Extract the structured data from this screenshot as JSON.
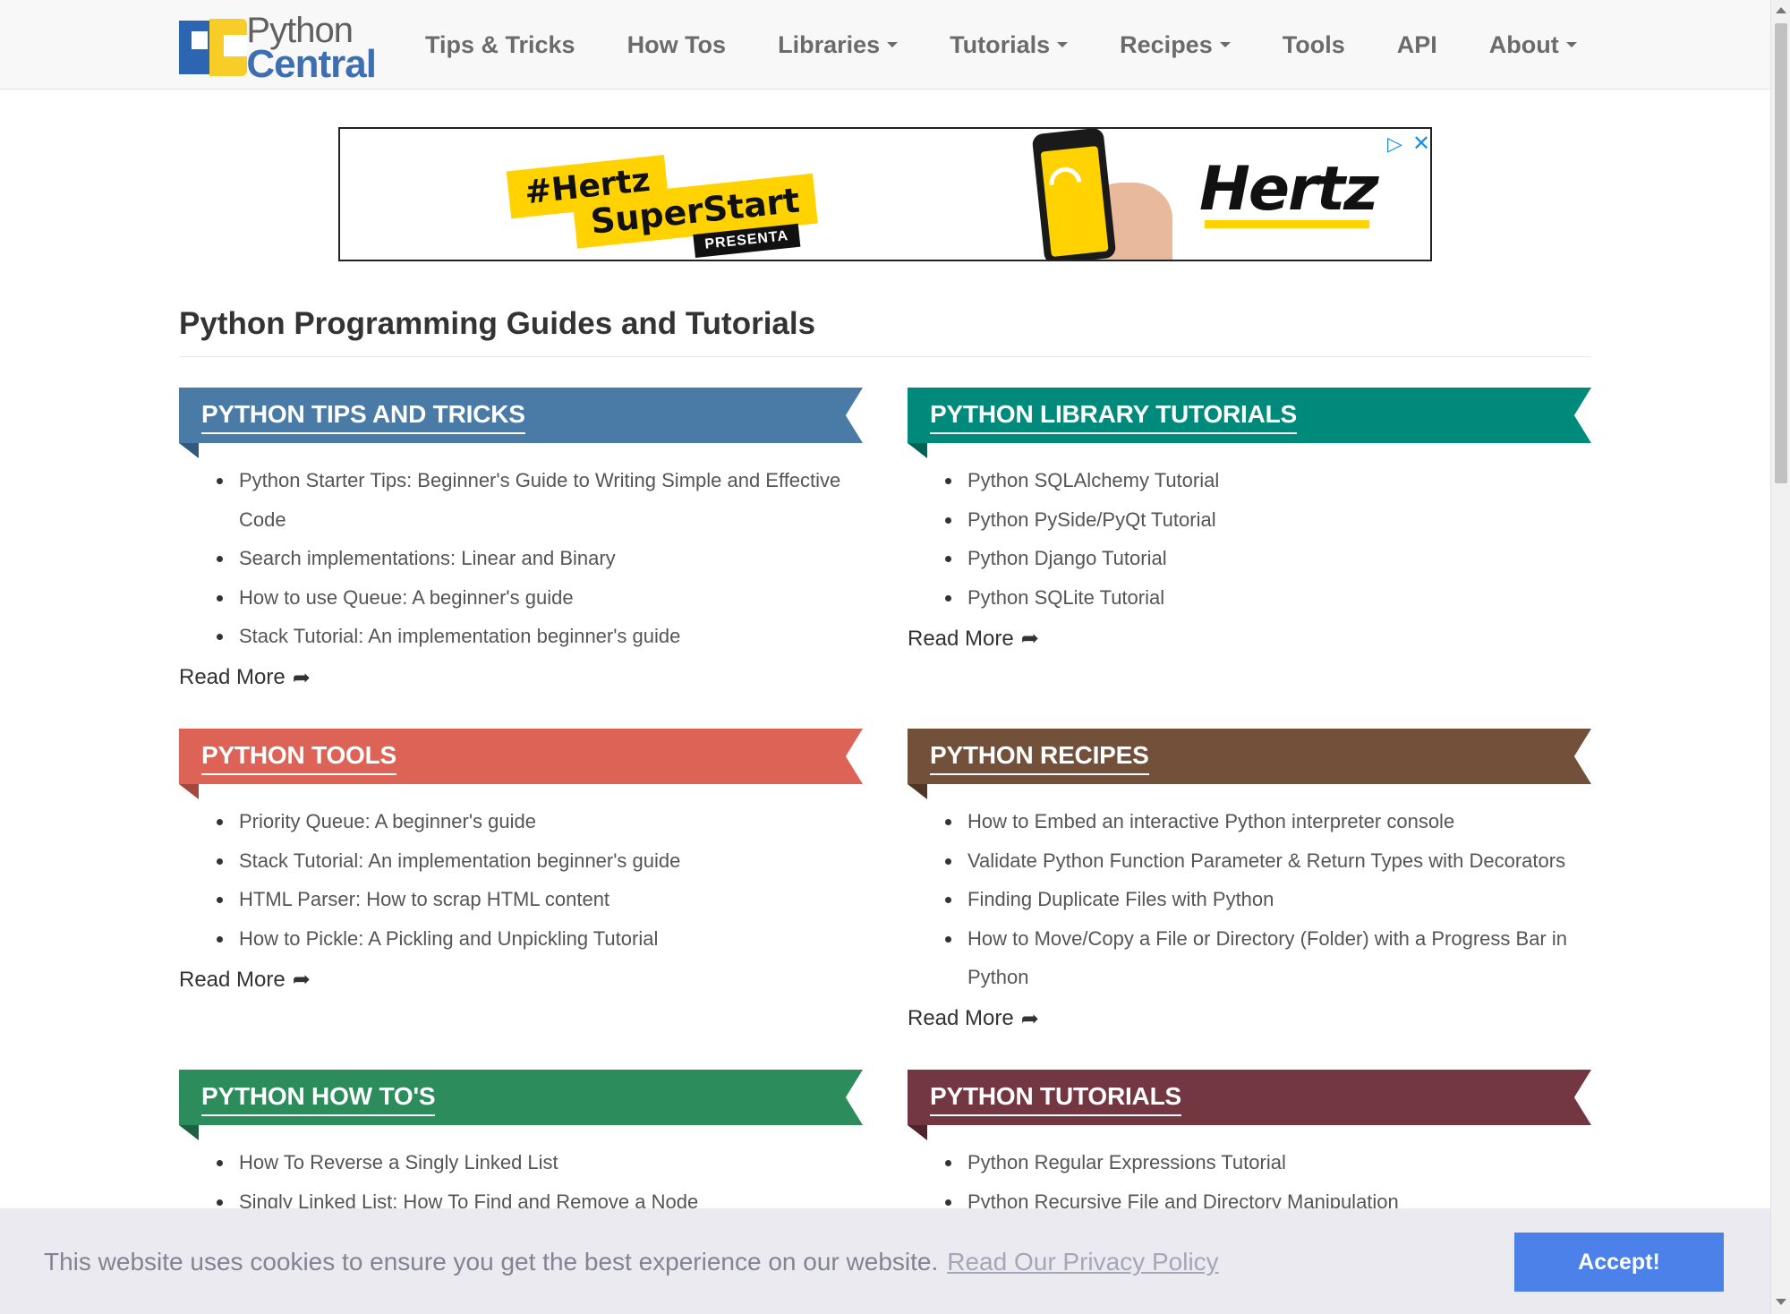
{
  "header": {
    "logo_line1": "Python",
    "logo_line2": "Central",
    "nav": [
      {
        "label": "Tips & Tricks"
      },
      {
        "label": "How Tos"
      },
      {
        "label": "Libraries"
      },
      {
        "label": "Tutorials"
      },
      {
        "label": "Recipes"
      },
      {
        "label": "Tools"
      },
      {
        "label": "API"
      },
      {
        "label": "About"
      }
    ]
  },
  "ad": {
    "sticker_line1": "#Hertz",
    "sticker_line2": "SuperStart",
    "sticker_line3": "PRESENTA",
    "brand": "Hertz",
    "choices_icon": "▷",
    "close_icon": "✕"
  },
  "main": {
    "page_title": "Python Programming Guides and Tutorials",
    "read_more_label": "Read More",
    "sections": [
      {
        "title": "PYTHON TIPS AND TRICKS",
        "color": "#4a7ba6",
        "items": [
          "Python Starter Tips: Beginner's Guide to Writing Simple and Effective Code",
          "Search implementations: Linear and Binary",
          "How to use Queue: A beginner's guide",
          "Stack Tutorial: An implementation beginner's guide"
        ]
      },
      {
        "title": "PYTHON LIBRARY TUTORIALS",
        "color": "#008a7c",
        "items": [
          "Python SQLAlchemy Tutorial",
          "Python PySide/PyQt Tutorial",
          "Python Django Tutorial",
          "Python SQLite Tutorial"
        ]
      },
      {
        "title": "PYTHON TOOLS",
        "color": "#dd6356",
        "items": [
          "Priority Queue: A beginner's guide",
          "Stack Tutorial: An implementation beginner's guide",
          "HTML Parser: How to scrap HTML content",
          "How to Pickle: A Pickling and Unpickling Tutorial"
        ]
      },
      {
        "title": "PYTHON RECIPES",
        "color": "#72503a",
        "items": [
          "How to Embed an interactive Python interpreter console",
          "Validate Python Function Parameter & Return Types with Decorators",
          "Finding Duplicate Files with Python",
          "How to Move/Copy a File or Directory (Folder) with a Progress Bar in Python"
        ]
      },
      {
        "title": "PYTHON HOW TO'S",
        "color": "#2c8c5c",
        "items": [
          "How To Reverse a Singly Linked List",
          "Singly Linked List: How To Find and Remove a Node"
        ]
      },
      {
        "title": "PYTHON TUTORIALS",
        "color": "#733741",
        "items": [
          "Python Regular Expressions Tutorial",
          "Python Recursive File and Directory Manipulation"
        ]
      }
    ]
  },
  "cookie": {
    "message": "This website uses cookies to ensure you get the best experience on our website.",
    "link": "Read Our Privacy Policy",
    "button": "Accept!"
  },
  "colors": {
    "accept_button": "#4b81e8",
    "navbar_bg": "#f8f8f8",
    "ad_yellow": "#ffd200"
  }
}
